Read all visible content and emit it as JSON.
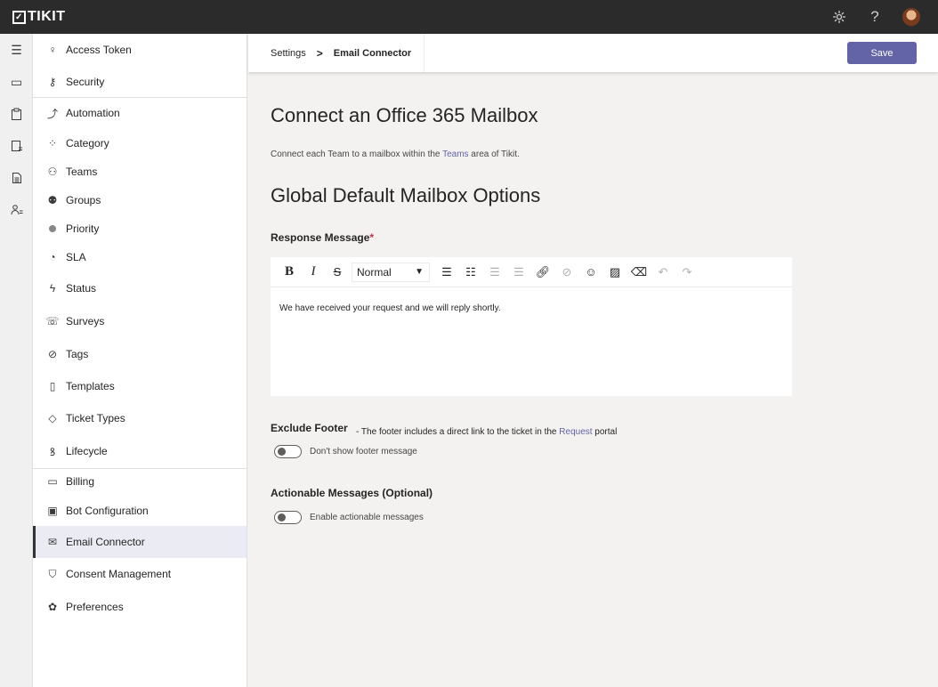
{
  "app": {
    "logo_text": "TIKIT"
  },
  "topbar": {
    "icons": [
      "gear-icon",
      "help-icon",
      "avatar"
    ]
  },
  "rail": {
    "icons": [
      "hamburger-icon",
      "inbox-icon",
      "clipboard-icon",
      "knowledge-icon",
      "document-icon",
      "people-icon"
    ]
  },
  "settings_nav": {
    "items": [
      {
        "label": "Access Token",
        "icon": "access-token-icon"
      },
      {
        "label": "Security",
        "icon": "security-icon"
      },
      {
        "label": "Automation",
        "icon": "automation-icon"
      },
      {
        "label": "Category",
        "icon": "category-icon"
      },
      {
        "label": "Teams",
        "icon": "teams-icon"
      },
      {
        "label": "Groups",
        "icon": "groups-icon"
      },
      {
        "label": "Priority",
        "icon": "priority-icon"
      },
      {
        "label": "SLA",
        "icon": "sla-icon"
      },
      {
        "label": "Status",
        "icon": "status-icon"
      },
      {
        "label": "Surveys",
        "icon": "surveys-icon"
      },
      {
        "label": "Tags",
        "icon": "tag-icon"
      },
      {
        "label": "Templates",
        "icon": "templates-icon"
      },
      {
        "label": "Ticket Types",
        "icon": "ticket-types-icon"
      },
      {
        "label": "Lifecycle",
        "icon": "lifecycle-icon"
      },
      {
        "label": "Billing",
        "icon": "billing-icon"
      },
      {
        "label": "Bot Configuration",
        "icon": "bot-icon"
      },
      {
        "label": "Email Connector",
        "icon": "email-icon",
        "active": true
      },
      {
        "label": "Consent Management",
        "icon": "shield-icon"
      },
      {
        "label": "Preferences",
        "icon": "palette-icon"
      }
    ]
  },
  "header": {
    "breadcrumb_root": "Settings",
    "breadcrumb_separator": ">",
    "breadcrumb_current": "Email Connector",
    "save_label": "Save"
  },
  "main": {
    "title": "Connect an Office 365 Mailbox",
    "intro_before": "Connect each Team to a mailbox within the ",
    "intro_link": "Teams",
    "intro_after": " area of Tikit.",
    "global_title": "Global Default Mailbox Options",
    "response_label": "Response Message",
    "required_mark": "*",
    "editor": {
      "format_value": "Normal",
      "content": "We have received your request and we will reply shortly."
    },
    "exclude_footer": {
      "label": "Exclude Footer",
      "note_before": "- The footer includes a direct link to the ticket in the ",
      "note_link": "Request",
      "note_after": " portal",
      "toggle_label": "Don't show footer message",
      "enabled": false
    },
    "actionable": {
      "label": "Actionable Messages (Optional)",
      "toggle_label": "Enable actionable messages",
      "enabled": false
    }
  },
  "colors": {
    "accent": "#6264a7",
    "topbar": "#2b2b2b",
    "required": "#c4314b"
  }
}
